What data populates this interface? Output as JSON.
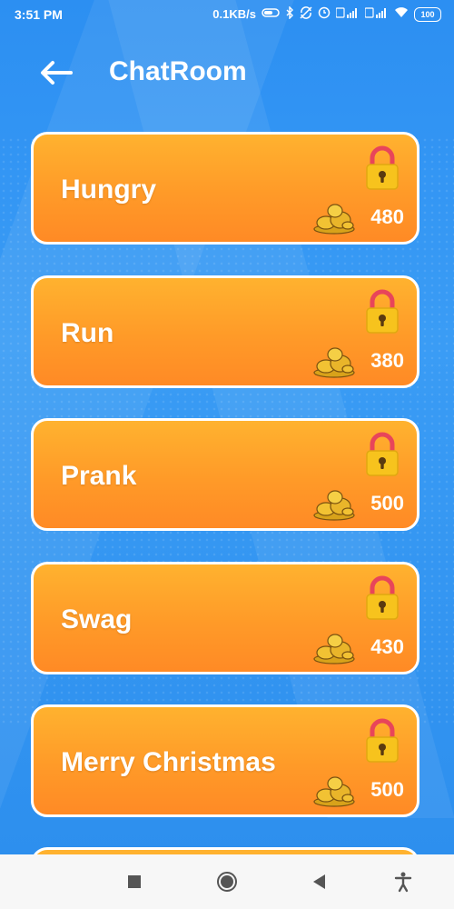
{
  "status_bar": {
    "time": "3:51 PM",
    "network_speed": "0.1KB/s",
    "battery": "100",
    "icons": [
      "alarm-icon",
      "bluetooth-icon",
      "sync-icon",
      "clock-icon",
      "signal-icon",
      "wifi-icon",
      "battery-icon"
    ]
  },
  "header": {
    "title": "ChatRoom",
    "back_icon": "back-arrow-icon"
  },
  "rooms": [
    {
      "name": "Hungry",
      "price": "480",
      "locked": true
    },
    {
      "name": "Run",
      "price": "380",
      "locked": true
    },
    {
      "name": "Prank",
      "price": "500",
      "locked": true
    },
    {
      "name": "Swag",
      "price": "430",
      "locked": true
    },
    {
      "name": "Merry Christmas",
      "price": "500",
      "locked": true
    }
  ],
  "colors": {
    "background": "#2f8ff0",
    "card": "#ff9a28",
    "lock_body": "#f7c31d",
    "lock_shackle": "#e8455a"
  },
  "nav_bar": {
    "icons": [
      "recents-square-icon",
      "home-circle-icon",
      "back-triangle-icon",
      "accessibility-icon"
    ]
  }
}
